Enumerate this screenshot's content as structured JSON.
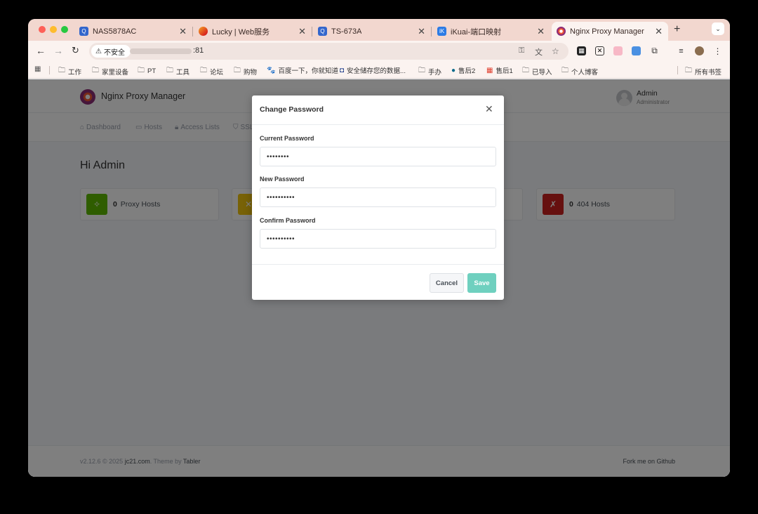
{
  "browser": {
    "tabs": [
      {
        "label": "NAS5878AC",
        "favicon": "qnap-icon"
      },
      {
        "label": "Lucky | Web服务",
        "favicon": "lucky-icon"
      },
      {
        "label": "TS-673A",
        "favicon": "qnap-icon"
      },
      {
        "label": "iKuai-端口映射",
        "favicon": "ikuai-icon"
      },
      {
        "label": "Nginx Proxy Manager",
        "favicon": "npm-icon",
        "active": true
      }
    ],
    "security_label": "不安全",
    "url": ":81",
    "bookmarks": [
      "工作",
      "家里设备",
      "PT",
      "工具",
      "论坛",
      "购物",
      "百度一下，你就知道",
      "安全储存您的数据...",
      "手办",
      "售后2",
      "售后1",
      "已导入",
      "个人博客"
    ],
    "all_bookmarks_label": "所有书签"
  },
  "app": {
    "brand": "Nginx Proxy Manager",
    "user": {
      "name": "Admin",
      "role": "Administrator"
    },
    "nav": [
      "Dashboard",
      "Hosts",
      "Access Lists",
      "SSL"
    ],
    "greeting": "Hi Admin",
    "cards": [
      {
        "count": "0",
        "label": "Proxy Hosts",
        "color": "#5eba00",
        "icon": "lightning-icon"
      },
      {
        "count": "",
        "label": "",
        "color": "#f1c40f",
        "icon": "redirect-icon"
      },
      {
        "count": "",
        "label": "",
        "color": "#ffffff",
        "icon": ""
      },
      {
        "count": "0",
        "label": "404 Hosts",
        "color": "#cd201f",
        "icon": "zap-off-icon"
      }
    ],
    "footer": {
      "version": "v2.12.6 © 2025",
      "author": "jc21.com",
      "theme_prefix": ". Theme by",
      "theme": "Tabler",
      "github": "Fork me on Github"
    }
  },
  "modal": {
    "title": "Change Password",
    "fields": [
      {
        "label": "Current Password",
        "value": "••••••••"
      },
      {
        "label": "New Password",
        "value": "••••••••••"
      },
      {
        "label": "Confirm Password",
        "value": "••••••••••"
      }
    ],
    "cancel_label": "Cancel",
    "save_label": "Save"
  }
}
